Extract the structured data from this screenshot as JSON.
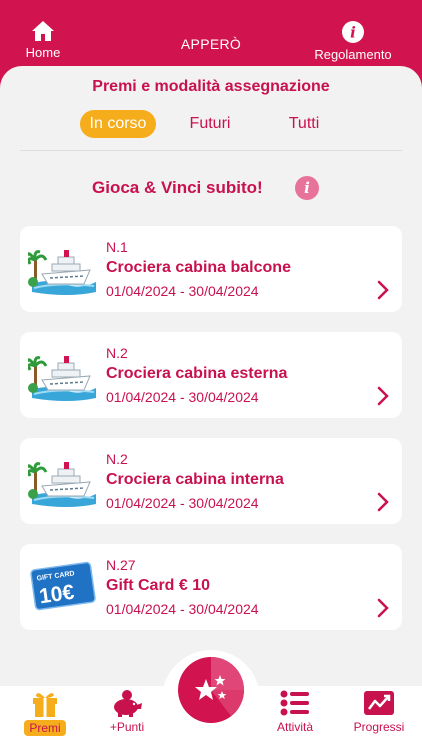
{
  "header": {
    "home_label": "Home",
    "title": "APPERÒ",
    "rules_label": "Regolamento",
    "info_glyph": "i"
  },
  "section": {
    "title": "Premi e modalità assegnazione"
  },
  "tabs": [
    {
      "label": "In corso",
      "active": true
    },
    {
      "label": "Futuri",
      "active": false
    },
    {
      "label": "Tutti",
      "active": false
    }
  ],
  "subtitle": "Gioca & Vinci subito!",
  "info_glyph": "i",
  "prizes": [
    {
      "number": "N.1",
      "name": "Crociera cabina balcone",
      "dates": "01/04/2024 - 30/04/2024",
      "icon": "cruise-ship-icon"
    },
    {
      "number": "N.2",
      "name": "Crociera cabina esterna",
      "dates": "01/04/2024 - 30/04/2024",
      "icon": "cruise-ship-icon"
    },
    {
      "number": "N.2",
      "name": "Crociera cabina interna",
      "dates": "01/04/2024 - 30/04/2024",
      "icon": "cruise-ship-icon"
    },
    {
      "number": "N.27",
      "name": "Gift Card € 10",
      "dates": "01/04/2024 - 30/04/2024",
      "icon": "gift-card-icon",
      "card_text": "GIFT CARD",
      "card_value": "10€"
    }
  ],
  "nav": {
    "premi": "Premi",
    "punti": "+Punti",
    "attivita": "Attività",
    "progressi": "Progressi"
  },
  "colors": {
    "brand": "#d1134f",
    "accent": "#f5ad1b",
    "background": "#f2f2f2",
    "info_pink": "#e7739b"
  }
}
